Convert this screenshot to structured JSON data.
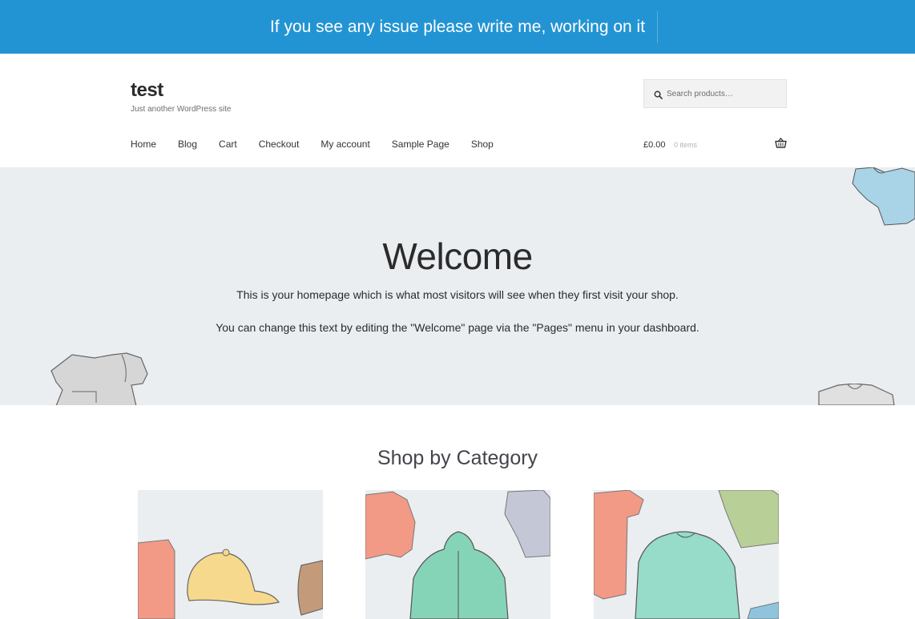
{
  "banner": {
    "text": "If you see any issue please write me, working on it"
  },
  "site": {
    "title": "test",
    "tagline": "Just another WordPress site"
  },
  "search": {
    "placeholder": "Search products…"
  },
  "nav": {
    "items": [
      "Home",
      "Blog",
      "Cart",
      "Checkout",
      "My account",
      "Sample Page",
      "Shop"
    ]
  },
  "cart": {
    "amount": "£0.00",
    "count": "0 items"
  },
  "hero": {
    "title": "Welcome",
    "paragraph1": "This is your homepage which is what most visitors will see when they first visit your shop.",
    "paragraph2": "You can change this text by editing the \"Welcome\" page via the \"Pages\" menu in your dashboard."
  },
  "section": {
    "title": "Shop by Category"
  },
  "colors": {
    "banner_bg": "#2394d3",
    "hero_bg": "#eaeef1"
  },
  "icons": [
    "search-icon",
    "basket-icon"
  ]
}
